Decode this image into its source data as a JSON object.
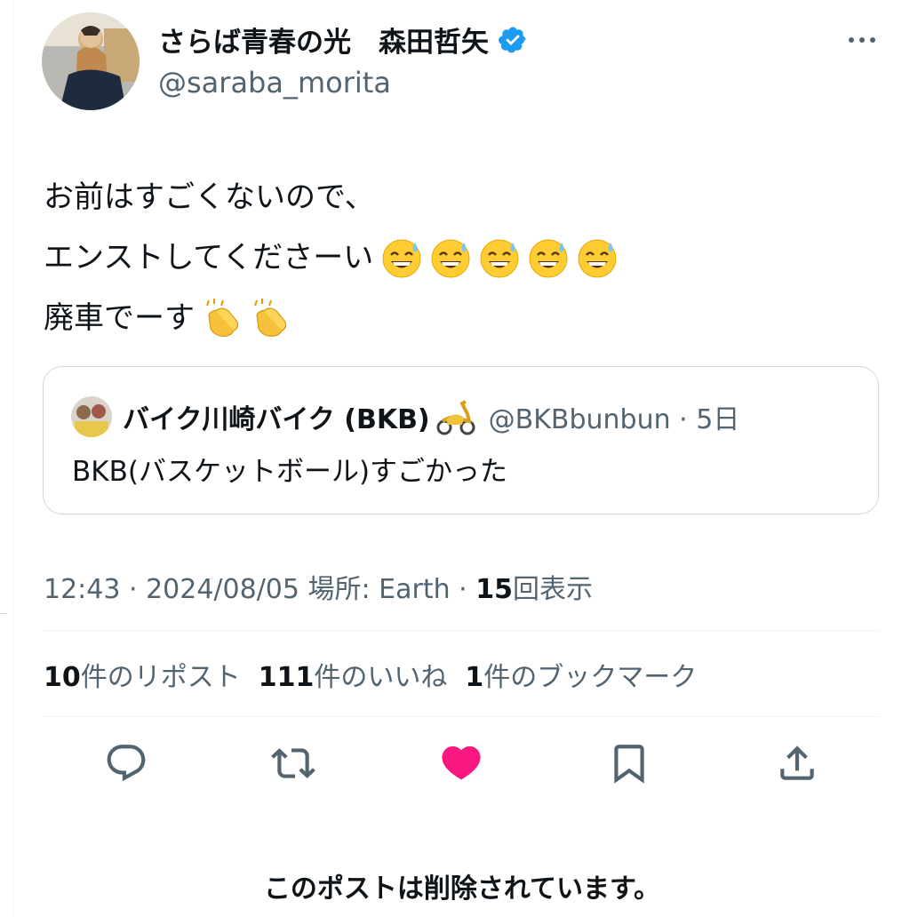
{
  "author": {
    "display_name": "さらば青春の光　森田哲矢",
    "handle": "@saraba_morita",
    "verified": true
  },
  "tweet": {
    "line1": "お前はすごくないので、",
    "line2": "エンストしてくださーい",
    "line2_emoji": "grinning-sweat-emoji x5",
    "line3": "廃車でーす",
    "line3_emoji": "clapping-hands-emoji x2"
  },
  "quote": {
    "display_name": "バイク川崎バイク (BKB)",
    "handle_time": "@BKBbunbun · 5日",
    "text": "BKB(バスケットボール)すごかった"
  },
  "meta": {
    "prefix": "12:43 · 2024/08/05 場所: Earth · ",
    "views_count": "15",
    "views_label": "回表示"
  },
  "stats": {
    "reposts_count": "10",
    "reposts_label": "件のリポスト",
    "likes_count": "111",
    "likes_label": "件のいいね",
    "bookmarks_count": "1",
    "bookmarks_label": "件のブックマーク"
  },
  "actions": [
    "reply-icon",
    "repost-icon",
    "like-icon",
    "bookmark-icon",
    "share-icon"
  ],
  "colors": {
    "like": "#f91880",
    "verified": "#1d9bf0",
    "muted": "#536471"
  },
  "deleted_notice": "このポストは削除されています。"
}
